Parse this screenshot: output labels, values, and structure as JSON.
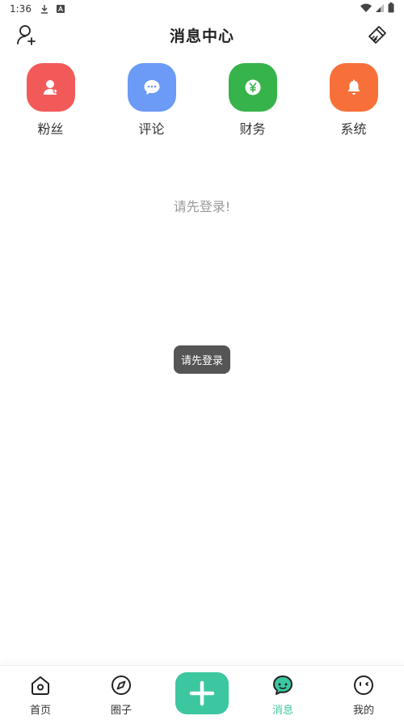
{
  "status_bar": {
    "time": "1:36",
    "icons": [
      "download-icon",
      "notification-a-icon",
      "wifi-icon",
      "signal-icon",
      "battery-icon"
    ]
  },
  "header": {
    "title": "消息中心",
    "left_icon": "add-user-icon",
    "right_icon": "clear-brush-icon"
  },
  "categories": [
    {
      "label": "粉丝",
      "icon": "fan-user-icon",
      "color": "#f25a5a"
    },
    {
      "label": "评论",
      "icon": "comment-bubble-icon",
      "color": "#6b9af7"
    },
    {
      "label": "财务",
      "icon": "yen-coin-icon",
      "color": "#36b34a"
    },
    {
      "label": "系统",
      "icon": "bell-icon",
      "color": "#f7703a"
    }
  ],
  "empty_message": "请先登录!",
  "toast": "请先登录",
  "tabbar": {
    "accent": "#3cc7a0",
    "tabs": [
      {
        "label": "首页",
        "icon": "home-icon"
      },
      {
        "label": "圈子",
        "icon": "compass-icon"
      },
      {
        "label": "",
        "icon": "plus-icon"
      },
      {
        "label": "消息",
        "icon": "message-icon",
        "active": true
      },
      {
        "label": "我的",
        "icon": "profile-face-icon"
      }
    ]
  }
}
